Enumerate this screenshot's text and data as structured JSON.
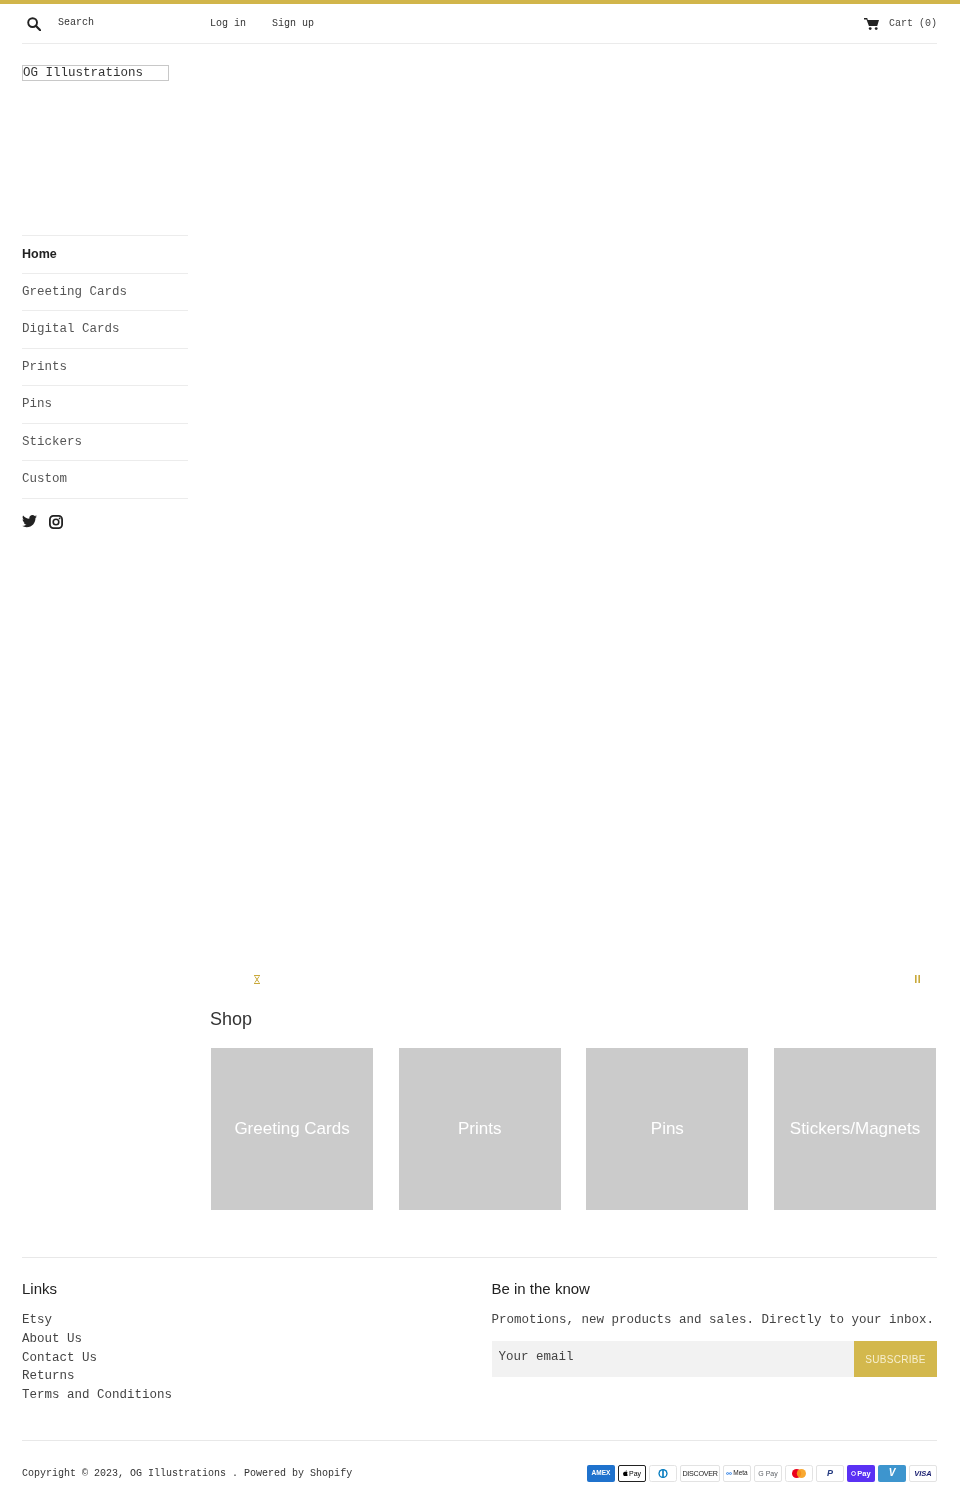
{
  "header": {
    "search": {
      "placeholder": "Search"
    },
    "links": [
      "Log in",
      "Sign up"
    ],
    "cart": "Cart (0)"
  },
  "sidebar": {
    "logo": "OG Illustrations",
    "nav": [
      {
        "label": "Home",
        "selected": true
      },
      {
        "label": "Greeting Cards",
        "selected": false
      },
      {
        "label": "Digital Cards",
        "selected": false
      },
      {
        "label": "Prints",
        "selected": false
      },
      {
        "label": "Pins",
        "selected": false
      },
      {
        "label": "Stickers",
        "selected": false
      },
      {
        "label": "Custom",
        "selected": false
      }
    ],
    "social": [
      {
        "kind": "bird"
      },
      {
        "kind": "camera"
      }
    ]
  },
  "slideshow": {
    "controls": [
      {
        "kind": "hourglass"
      },
      {
        "kind": "pause"
      }
    ]
  },
  "shop": {
    "title": "Shop",
    "collections": [
      "Greeting Cards",
      "Prints",
      "Pins",
      "Stickers/Magnets"
    ]
  },
  "footer": {
    "links": {
      "title": "Links",
      "items": [
        "Etsy",
        "About Us",
        "Contact Us",
        "Returns",
        "Terms and Conditions"
      ]
    },
    "newsletter": {
      "title": "Be in the know",
      "text": "Promotions, new products and sales. Directly to your inbox.",
      "email": {
        "placeholder": "Your email"
      },
      "button": "SUBSCRIBE"
    }
  },
  "bottom_bar": {
    "copyright": "Copyright © 2023,",
    "shop_link": "OG Illustrations",
    "separator": ".",
    "powered_by": "Powered by Shopify",
    "payment_icons": [
      {
        "kind": "amex",
        "label": "AMEX"
      },
      {
        "kind": "apple_pay",
        "label": "Pay"
      },
      {
        "kind": "diners"
      },
      {
        "kind": "discover",
        "label": "DISCOVER"
      },
      {
        "kind": "meta_pay",
        "label": "Meta"
      },
      {
        "kind": "google_pay",
        "label": "G Pay"
      },
      {
        "kind": "mastercard"
      },
      {
        "kind": "paypal",
        "label": "P"
      },
      {
        "kind": "shop_pay",
        "label": "Pay"
      },
      {
        "kind": "venmo",
        "label": "V"
      },
      {
        "kind": "visa",
        "label": "VISA"
      }
    ]
  }
}
